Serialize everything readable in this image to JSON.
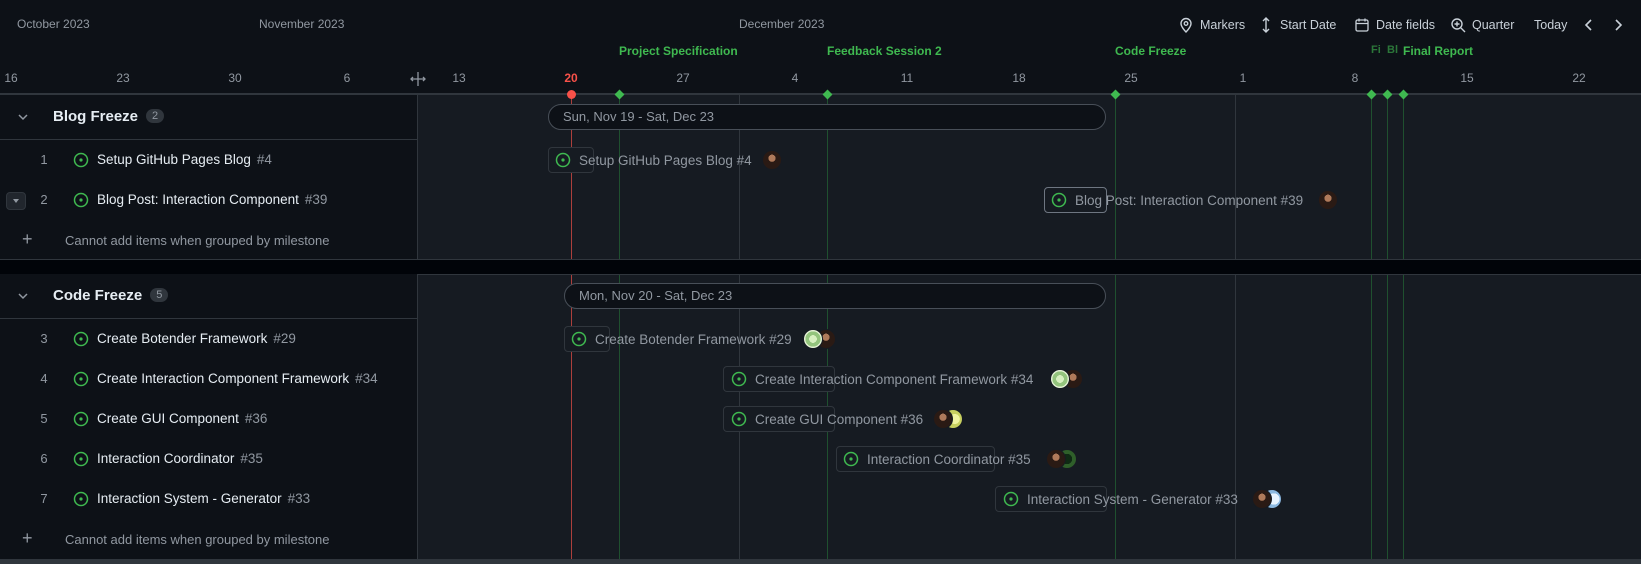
{
  "timeline": {
    "months": [
      "October 2023",
      "November 2023",
      "December 2023"
    ],
    "days": [
      "16",
      "23",
      "30",
      "6",
      "13",
      "20",
      "27",
      "4",
      "11",
      "18",
      "25",
      "1",
      "8",
      "15",
      "22"
    ],
    "today_day": "20",
    "milestones": {
      "project_spec": "Project Specification",
      "feedback": "Feedback Session 2",
      "code_freeze": "Code Freeze",
      "fi": "Fi",
      "bl": "Bl",
      "final_report": "Final Report"
    }
  },
  "toolbar": {
    "markers": "Markers",
    "start_date": "Start Date",
    "date_fields": "Date fields",
    "zoom": "Quarter",
    "today": "Today"
  },
  "groups": [
    {
      "title": "Blog Freeze",
      "count": "2",
      "range": "Sun, Nov 19 - Sat, Dec 23",
      "items": [
        {
          "index": "1",
          "title": "Setup GitHub Pages Blog",
          "number": "#4",
          "bar_label": "Setup GitHub Pages Blog #4"
        },
        {
          "index": "2",
          "title": "Blog Post: Interaction Component",
          "number": "#39",
          "bar_label": "Blog Post: Interaction Component #39"
        }
      ],
      "add_text": "Cannot add items when grouped by milestone"
    },
    {
      "title": "Code Freeze",
      "count": "5",
      "range": "Mon, Nov 20 - Sat, Dec 23",
      "items": [
        {
          "index": "3",
          "title": "Create Botender Framework",
          "number": "#29",
          "bar_label": "Create Botender Framework #29"
        },
        {
          "index": "4",
          "title": "Create Interaction Component Framework",
          "number": "#34",
          "bar_label": "Create Interaction Component Framework #34"
        },
        {
          "index": "5",
          "title": "Create GUI Component",
          "number": "#36",
          "bar_label": "Create GUI Component #36"
        },
        {
          "index": "6",
          "title": "Interaction Coordinator",
          "number": "#35",
          "bar_label": "Interaction Coordinator #35"
        },
        {
          "index": "7",
          "title": "Interaction System - Generator",
          "number": "#33",
          "bar_label": "Interaction System - Generator #33"
        }
      ],
      "add_text": "Cannot add items when grouped by milestone"
    }
  ],
  "colors": {
    "accent_green": "#3fb950",
    "today_red": "#f85149",
    "background": "#0d1117",
    "grid": "#161b22"
  }
}
